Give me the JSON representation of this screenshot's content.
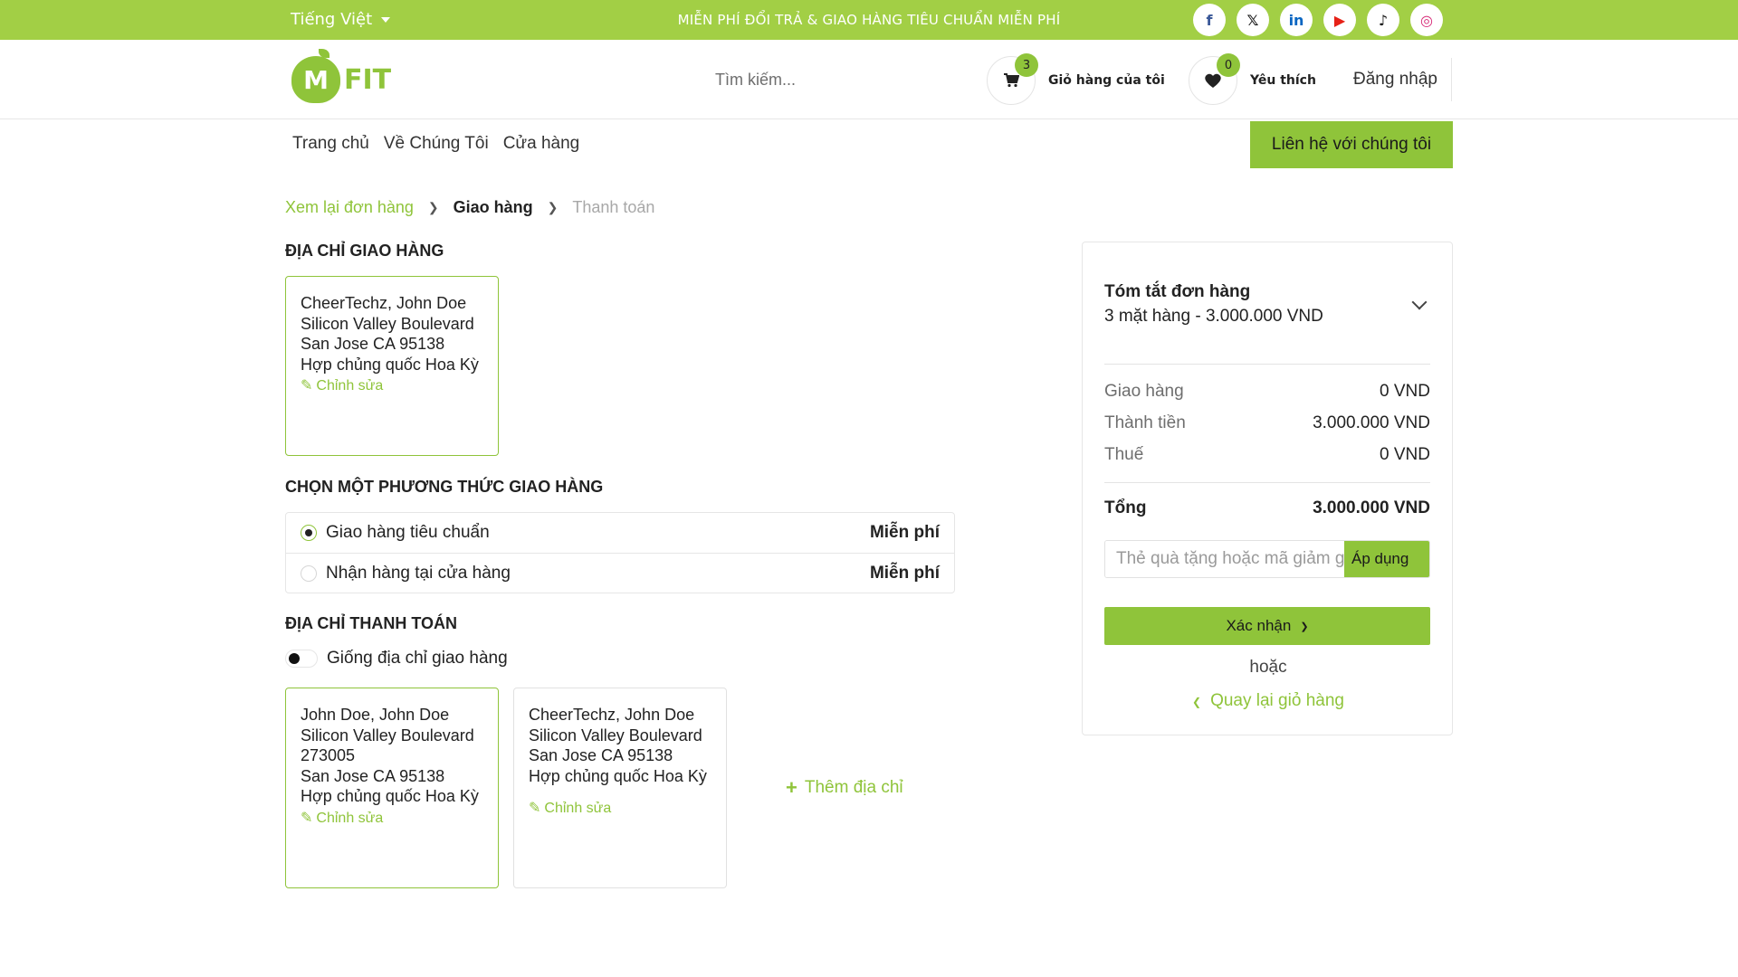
{
  "topbar": {
    "language": "Tiếng Việt",
    "promo": "MIỄN PHÍ ĐỔI TRẢ & GIAO HÀNG TIÊU CHUẨN MIỄN PHÍ",
    "socials": [
      {
        "icon": "facebook-icon",
        "glyph": "f",
        "color": "#3b5998"
      },
      {
        "icon": "x-twitter-icon",
        "glyph": "𝕏",
        "color": "#111111"
      },
      {
        "icon": "linkedin-icon",
        "glyph": "in",
        "color": "#0a66c2"
      },
      {
        "icon": "youtube-icon",
        "glyph": "▶",
        "color": "#e62117"
      },
      {
        "icon": "tiktok-icon",
        "glyph": "♪",
        "color": "#111111"
      },
      {
        "icon": "instagram-icon",
        "glyph": "◎",
        "color": "#d62976"
      }
    ]
  },
  "header": {
    "logo_letter": "M",
    "logo_text": "FIT",
    "search_placeholder": "Tìm kiếm...",
    "cart_label": "Giỏ hàng của tôi",
    "cart_count": "3",
    "wishlist_label": "Yêu thích",
    "wishlist_count": "0",
    "login": "Đăng nhập"
  },
  "nav": {
    "items": [
      "Trang chủ",
      "Về Chúng Tôi",
      "Cửa hàng"
    ],
    "contact": "Liên hệ với chúng tôi"
  },
  "breadcrumb": {
    "step1": "Xem lại đơn hàng",
    "step2": "Giao hàng",
    "step3": "Thanh toán"
  },
  "shipping_address": {
    "title": "ĐỊA CHỈ GIAO HÀNG",
    "card": {
      "lines": [
        "CheerTechz, John Doe",
        "Silicon Valley Boulevard",
        "San Jose CA 95138",
        "Hợp chủng quốc Hoa Kỳ"
      ],
      "edit": "Chỉnh sửa"
    }
  },
  "shipping_method": {
    "title": "CHỌN MỘT PHƯƠNG THỨC GIAO HÀNG",
    "options": [
      {
        "label": "Giao hàng tiêu chuẩn",
        "price": "Miễn phí",
        "selected": true
      },
      {
        "label": "Nhận hàng tại cửa hàng",
        "price": "Miễn phí",
        "selected": false
      }
    ]
  },
  "billing": {
    "title": "ĐỊA CHỈ THANH TOÁN",
    "same_as_shipping": "Giống địa chỉ giao hàng",
    "cards": [
      {
        "lines": [
          "John Doe, John Doe",
          "Silicon Valley Boulevard",
          "273005",
          "San Jose CA 95138",
          "Hợp chủng quốc Hoa Kỳ"
        ],
        "edit": "Chỉnh sửa"
      },
      {
        "lines": [
          "CheerTechz, John Doe",
          "Silicon Valley Boulevard",
          "San Jose CA 95138",
          "Hợp chủng quốc Hoa Kỳ"
        ],
        "edit": "Chỉnh sửa"
      }
    ],
    "add": "Thêm địa chỉ"
  },
  "summary": {
    "title": "Tóm tắt đơn hàng",
    "items": "3 mặt hàng -  3.000.000 VND",
    "shipping_label": "Giao hàng",
    "shipping_value": "0 VND",
    "subtotal_label": "Thành tiền",
    "subtotal_value": "3.000.000 VND",
    "tax_label": "Thuế",
    "tax_value": "0 VND",
    "total_label": "Tổng",
    "total_value": "3.000.000 VND",
    "coupon_placeholder": "Thẻ quà tặng hoặc mã giảm giá",
    "apply": "Áp dụng",
    "confirm": "Xác nhận",
    "or": "hoặc",
    "back": "Quay lại giỏ hàng"
  },
  "colors": {
    "accent": "#8fc43a",
    "topbar": "#a2cf45"
  }
}
